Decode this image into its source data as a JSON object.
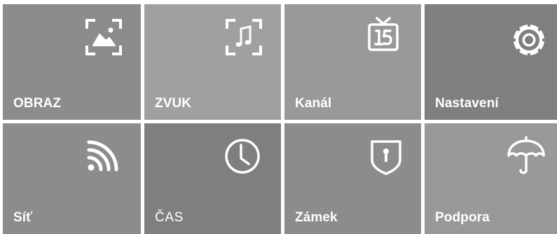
{
  "menu": {
    "tiles": [
      {
        "label": "OBRAZ",
        "icon": "picture-icon",
        "color": "#8c8c8c"
      },
      {
        "label": "ZVUK",
        "icon": "music-icon",
        "color": "#a0a0a0"
      },
      {
        "label": "Kanál",
        "icon": "tv-channel-icon",
        "color": "#999999"
      },
      {
        "label": "Nastavení",
        "icon": "gear-icon",
        "color": "#7f7f7f"
      },
      {
        "label": "Síť",
        "icon": "wifi-icon",
        "color": "#8c8c8c"
      },
      {
        "label": "ČAS",
        "icon": "clock-icon",
        "color": "#7f7f7f"
      },
      {
        "label": "Zámek",
        "icon": "lock-shield-icon",
        "color": "#8c8c8c"
      },
      {
        "label": "Podpora",
        "icon": "umbrella-icon",
        "color": "#999999"
      }
    ]
  }
}
